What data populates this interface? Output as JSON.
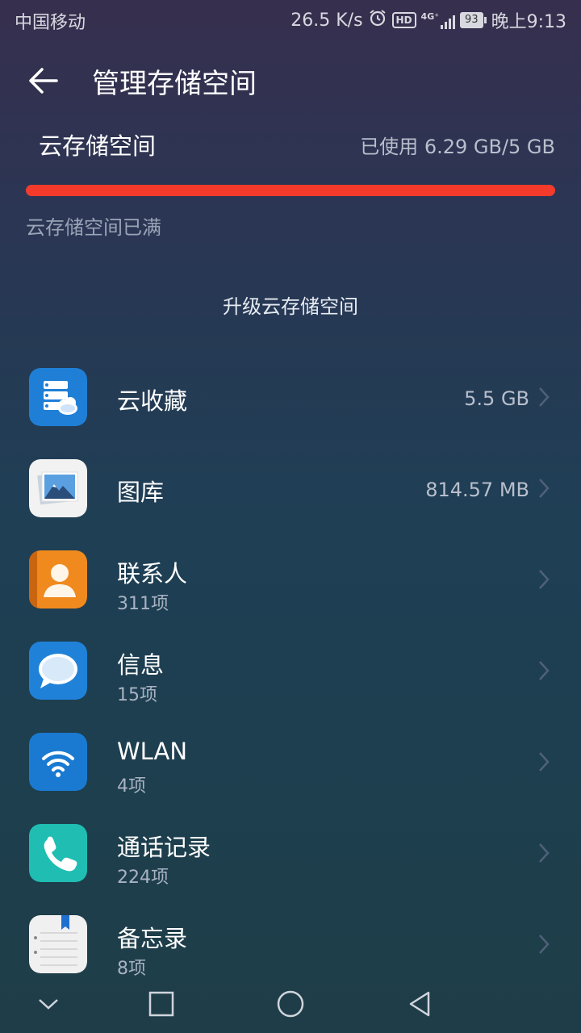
{
  "status": {
    "carrier": "中国移动",
    "speed": "26.5 K/s",
    "hd": "HD",
    "network": "4G⁺",
    "battery": "93",
    "time": "晚上9:13"
  },
  "header": {
    "title": "管理存储空间"
  },
  "storage": {
    "label": "云存储空间",
    "used_text": "已使用 6.29 GB/5 GB",
    "used_fraction": 1.0,
    "full_note": "云存储空间已满",
    "upgrade": "升级云存储空间",
    "bar_color": "#f33a2b"
  },
  "items": [
    {
      "name": "云收藏",
      "size": "5.5 GB",
      "icon": "cloud-favorites-icon"
    },
    {
      "name": "图库",
      "size": "814.57 MB",
      "icon": "gallery-icon"
    },
    {
      "name": "联系人",
      "count": "311项",
      "icon": "contacts-icon"
    },
    {
      "name": "信息",
      "count": "15项",
      "icon": "messages-icon"
    },
    {
      "name": "WLAN",
      "count": "4项",
      "icon": "wlan-icon"
    },
    {
      "name": "通话记录",
      "count": "224项",
      "icon": "call-log-icon"
    },
    {
      "name": "备忘录",
      "count": "8项",
      "icon": "notepad-icon"
    }
  ],
  "nav": [
    "chevron-down-icon",
    "recents-square-icon",
    "home-circle-icon",
    "back-triangle-icon"
  ]
}
